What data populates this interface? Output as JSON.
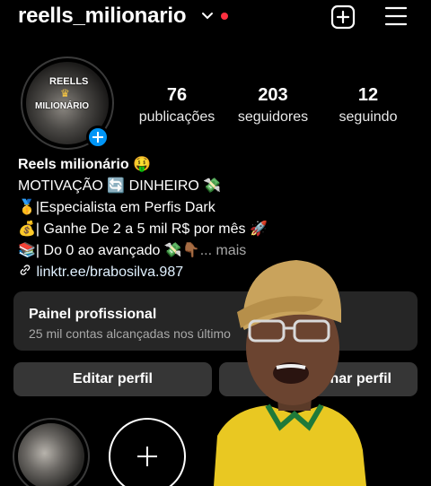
{
  "header": {
    "username": "reells_milionario",
    "icons": [
      "chevron-down-icon",
      "notification-dot",
      "add-square-icon",
      "menu-icon"
    ],
    "dot_color": "#ff3040"
  },
  "profile": {
    "avatar_text_line1": "REELLS",
    "avatar_text_line2": "MILIONÁRIO",
    "stats": [
      {
        "value": "76",
        "label": "publicações"
      },
      {
        "value": "203",
        "label": "seguidores"
      },
      {
        "value": "12",
        "label": "seguindo"
      }
    ]
  },
  "bio": {
    "name": "Reels milionário 🤑",
    "lines": [
      "MOTIVAÇÃO 🔄 DINHEIRO 💸",
      "🥇|Especialista em Perfis Dark",
      "💰| Ganhe De 2 a 5 mil R$ por mês 🚀",
      "📚| Do 0 ao avançado 💸👇🏾"
    ],
    "more": "... mais",
    "link": "linktr.ee/brabosilva.987"
  },
  "panel": {
    "title": "Painel profissional",
    "subtitle": "25 mil contas alcançadas nos último"
  },
  "buttons": {
    "edit": "Editar perfil",
    "share": "lhar perfil"
  },
  "colors": {
    "background": "#000000",
    "panel": "#262626",
    "button": "#363636",
    "accent": "#0095f6"
  }
}
